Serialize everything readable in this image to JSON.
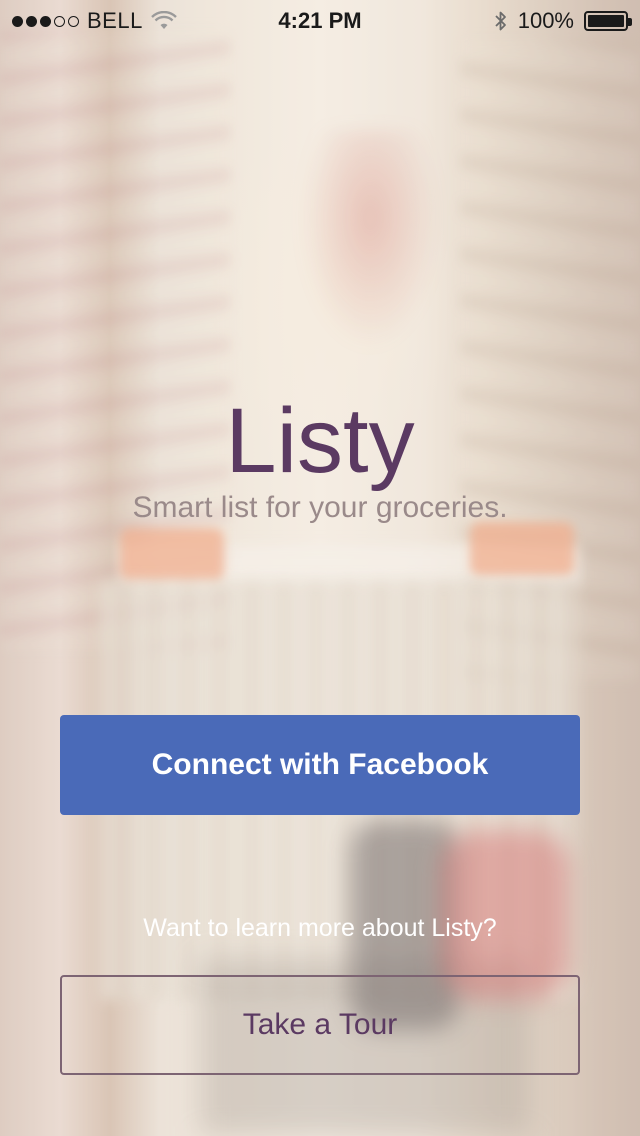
{
  "status_bar": {
    "carrier": "BELL",
    "signal_bars_filled": 3,
    "signal_bars_total": 5,
    "time": "4:21 PM",
    "battery_text": "100%",
    "battery_level": 1.0,
    "icons": [
      "signal-dots-icon",
      "wifi-icon",
      "bluetooth-icon",
      "battery-icon"
    ]
  },
  "app": {
    "title": "Listy",
    "tagline": "Smart list for your groceries."
  },
  "actions": {
    "facebook_label": "Connect with Facebook",
    "learn_more": "Want to learn more about Listy?",
    "tour_label": "Take a Tour"
  },
  "colors": {
    "title": "#5b3a62",
    "tagline": "#9a8a8a",
    "facebook": "#4a6ab8",
    "tour_border": "#7d6473"
  }
}
